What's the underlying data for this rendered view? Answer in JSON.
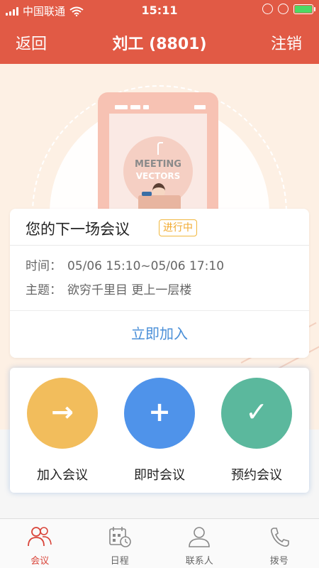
{
  "status_bar": {
    "carrier": "中国联通",
    "time": "15:11"
  },
  "nav": {
    "back_label": "返回",
    "title": "刘工 (8801)",
    "logout_label": "注销"
  },
  "hero": {
    "illustration_text_1": "MEETING",
    "illustration_text_2": "VECTORS"
  },
  "next_meeting": {
    "title": "您的下一场会议",
    "status_badge": "进行中",
    "time_label": "时间：",
    "time_value": "05/06 15:10~05/06 17:10",
    "topic_label": "主题：",
    "topic_value": "欲穷千里目 更上一层楼",
    "join_label": "立即加入"
  },
  "actions": [
    {
      "label": "加入会议",
      "icon": "arrow-right-icon",
      "symbol": "→",
      "color": "#f2bd5c"
    },
    {
      "label": "即时会议",
      "icon": "plus-icon",
      "symbol": "+",
      "color": "#4f93ea"
    },
    {
      "label": "预约会议",
      "icon": "check-icon",
      "symbol": "✓",
      "color": "#5bb89d"
    }
  ],
  "tabs": [
    {
      "label": "会议",
      "icon": "people-icon",
      "active": true
    },
    {
      "label": "日程",
      "icon": "calendar-clock-icon",
      "active": false
    },
    {
      "label": "联系人",
      "icon": "person-icon",
      "active": false
    },
    {
      "label": "拨号",
      "icon": "phone-icon",
      "active": false
    }
  ],
  "colors": {
    "brand": "#e15a45",
    "accent_blue": "#4a8fd8",
    "tab_active": "#d9453a"
  }
}
